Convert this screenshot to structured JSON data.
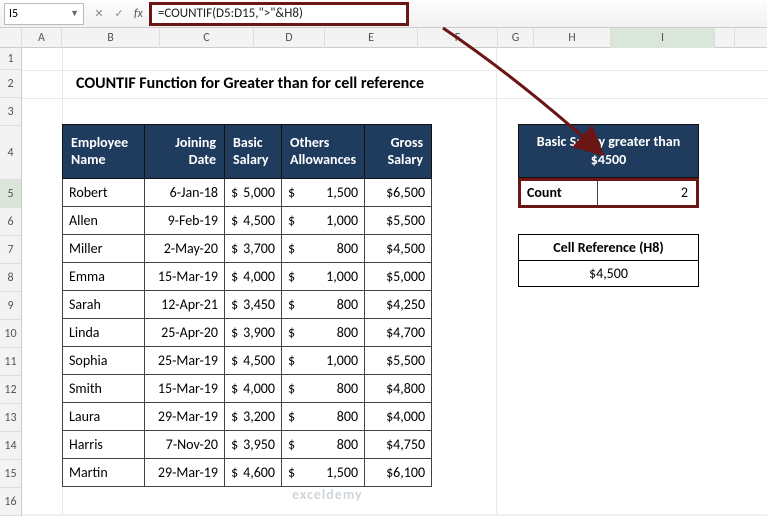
{
  "toolbar": {
    "namebox": "I5",
    "fx_label": "fx",
    "formula": "=COUNTIF(D5:D15,\">\"&H8)"
  },
  "columns": [
    "",
    "A",
    "B",
    "C",
    "D",
    "E",
    "F",
    "G",
    "H",
    "I",
    ""
  ],
  "row_labels": [
    "1",
    "2",
    "3",
    "4",
    "5",
    "6",
    "7",
    "8",
    "9",
    "10",
    "11",
    "12",
    "13",
    "14",
    "15",
    "16"
  ],
  "title": "COUNTIF Function for Greater than for cell reference",
  "headers": {
    "name": "Employee Name",
    "date": "Joining Date",
    "salary": "Basic Salary",
    "allow": "Others Allowances",
    "gross": "Gross Salary"
  },
  "rows": [
    {
      "name": "Robert",
      "date": "6-Jan-18",
      "salary": "5,000",
      "allow": "1,500",
      "gross": "$6,500"
    },
    {
      "name": "Allen",
      "date": "9-Feb-19",
      "salary": "4,500",
      "allow": "1,000",
      "gross": "$5,500"
    },
    {
      "name": "Miller",
      "date": "2-May-20",
      "salary": "3,700",
      "allow": "800",
      "gross": "$4,500"
    },
    {
      "name": "Emma",
      "date": "15-Mar-19",
      "salary": "4,000",
      "allow": "1,000",
      "gross": "$5,000"
    },
    {
      "name": "Sarah",
      "date": "12-Apr-21",
      "salary": "3,450",
      "allow": "800",
      "gross": "$4,250"
    },
    {
      "name": "Linda",
      "date": "25-Apr-20",
      "salary": "3,900",
      "allow": "800",
      "gross": "$4,700"
    },
    {
      "name": "Sophia",
      "date": "25-Mar-19",
      "salary": "4,500",
      "allow": "1,000",
      "gross": "$5,500"
    },
    {
      "name": "Smith",
      "date": "15-Mar-19",
      "salary": "4,000",
      "allow": "800",
      "gross": "$4,800"
    },
    {
      "name": "Laura",
      "date": "29-Mar-19",
      "salary": "3,200",
      "allow": "800",
      "gross": "$4,000"
    },
    {
      "name": "Harris",
      "date": "7-Nov-20",
      "salary": "3,950",
      "allow": "800",
      "gross": "$4,750"
    },
    {
      "name": "Martin",
      "date": "29-Mar-19",
      "salary": "4,600",
      "allow": "1,500",
      "gross": "$6,100"
    }
  ],
  "result": {
    "header": "Basic Salary greater than $4500",
    "label": "Count",
    "value": "2"
  },
  "cellref": {
    "header": "Cell Reference (H8)",
    "value": "$4,500"
  },
  "watermark": "exceldemy",
  "chart_data": {
    "type": "table",
    "title": "COUNTIF Function for Greater than for cell reference",
    "columns": [
      "Employee Name",
      "Joining Date",
      "Basic Salary",
      "Others Allowances",
      "Gross Salary"
    ],
    "data": [
      [
        "Robert",
        "6-Jan-18",
        5000,
        1500,
        6500
      ],
      [
        "Allen",
        "9-Feb-19",
        4500,
        1000,
        5500
      ],
      [
        "Miller",
        "2-May-20",
        3700,
        800,
        4500
      ],
      [
        "Emma",
        "15-Mar-19",
        4000,
        1000,
        5000
      ],
      [
        "Sarah",
        "12-Apr-21",
        3450,
        800,
        4250
      ],
      [
        "Linda",
        "25-Apr-20",
        3900,
        800,
        4700
      ],
      [
        "Sophia",
        "25-Mar-19",
        4500,
        1000,
        5500
      ],
      [
        "Smith",
        "15-Mar-19",
        4000,
        800,
        4800
      ],
      [
        "Laura",
        "29-Mar-19",
        3200,
        800,
        4000
      ],
      [
        "Harris",
        "7-Nov-20",
        3950,
        800,
        4750
      ],
      [
        "Martin",
        "29-Mar-19",
        4600,
        1500,
        6100
      ]
    ],
    "formula": "=COUNTIF(D5:D15,\">\"&H8)",
    "threshold_ref": "H8",
    "threshold_value": 4500,
    "count_result": 2
  }
}
